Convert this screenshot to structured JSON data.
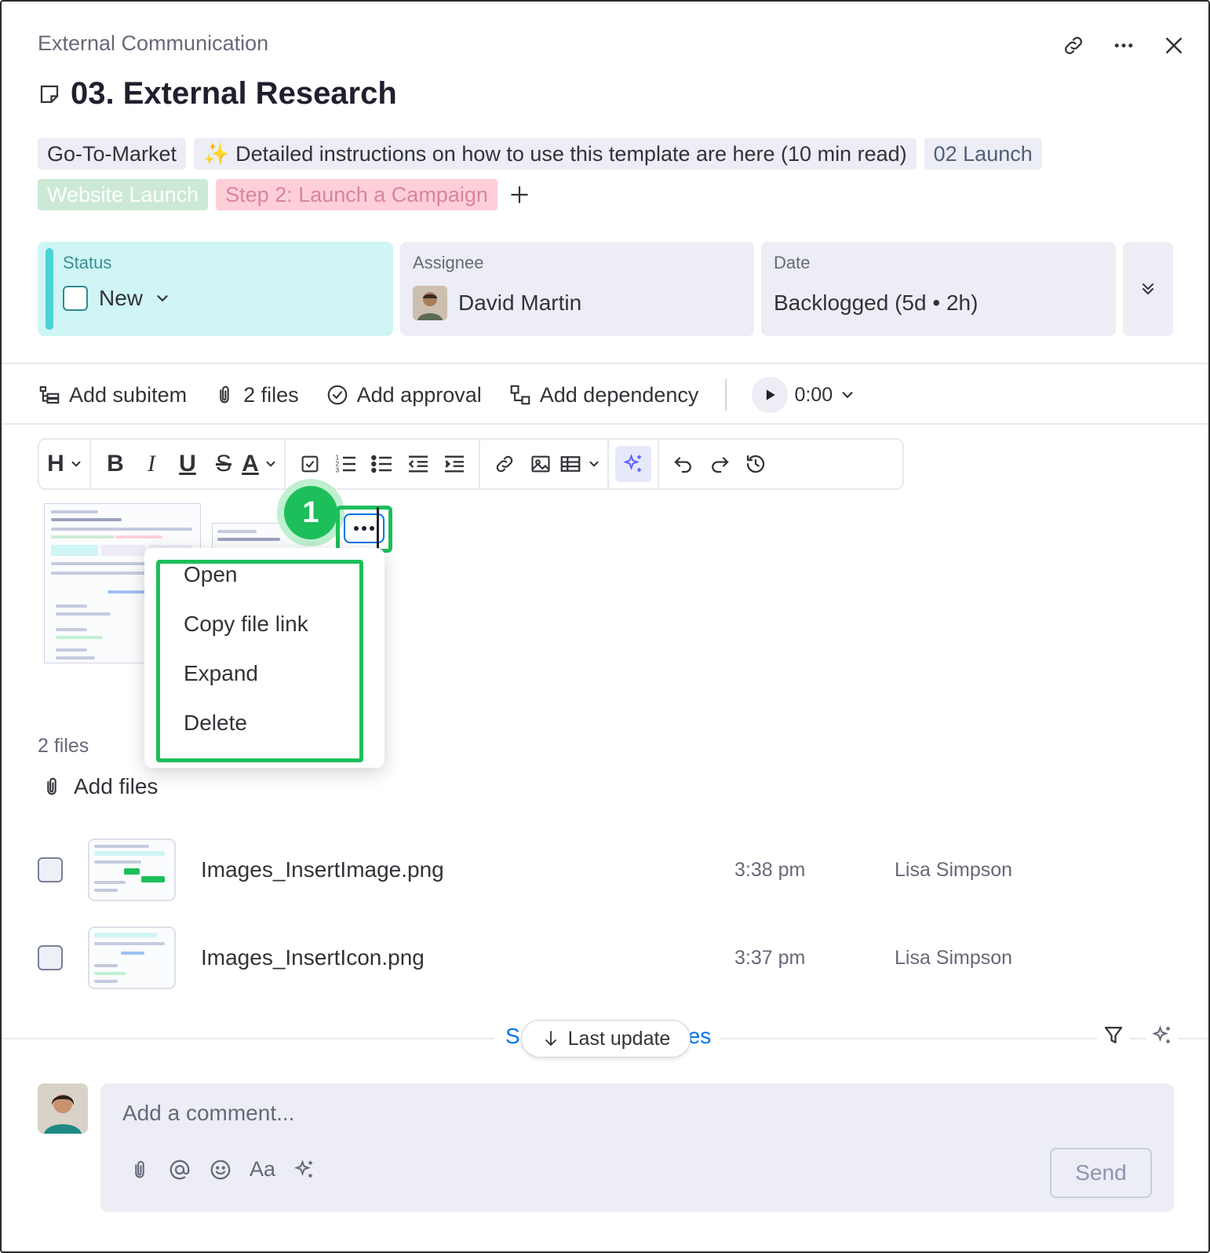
{
  "header": {
    "breadcrumb": "External Communication",
    "title": "03. External Research"
  },
  "tags": [
    {
      "label": "Go-To-Market",
      "style": "default"
    },
    {
      "label": "✨ Detailed instructions on how to use this template are here (10 min read)",
      "style": "default"
    },
    {
      "label": "02 Launch",
      "style": "blue"
    },
    {
      "label": "Website Launch",
      "style": "green"
    },
    {
      "label": "Step 2: Launch a Campaign",
      "style": "pink"
    }
  ],
  "columns": {
    "status": {
      "label": "Status",
      "value": "New"
    },
    "assignee": {
      "label": "Assignee",
      "value": "David Martin"
    },
    "date": {
      "label": "Date",
      "value": "Backlogged (5d • 2h)"
    }
  },
  "actions": {
    "add_subitem": "Add subitem",
    "files": "2 files",
    "add_approval": "Add approval",
    "add_dependency": "Add dependency",
    "timer": "0:00"
  },
  "toolbar": {
    "heading": "H",
    "bold": "B",
    "italic": "I",
    "underline": "U",
    "strike": "S",
    "text_color": "A"
  },
  "step_badge": "1",
  "context_menu": {
    "items": [
      "Open",
      "Copy file link",
      "Expand",
      "Delete"
    ]
  },
  "files_section": {
    "count_label": "2 files",
    "add_files": "Add files",
    "rows": [
      {
        "name": "Images_InsertImage.png",
        "time": "3:38 pm",
        "user": "Lisa Simpson"
      },
      {
        "name": "Images_InsertIcon.png",
        "time": "3:37 pm",
        "user": "Lisa Simpson"
      }
    ]
  },
  "updates": {
    "show_updates_left": "S",
    "show_updates_right": "es",
    "last_update": "Last update"
  },
  "comment": {
    "placeholder": "Add a comment...",
    "format_label": "Aa",
    "send": "Send"
  },
  "colors": {
    "highlight": "#1dbf5a",
    "status_bg": "#cff5f5",
    "primary": "#0073ea"
  }
}
